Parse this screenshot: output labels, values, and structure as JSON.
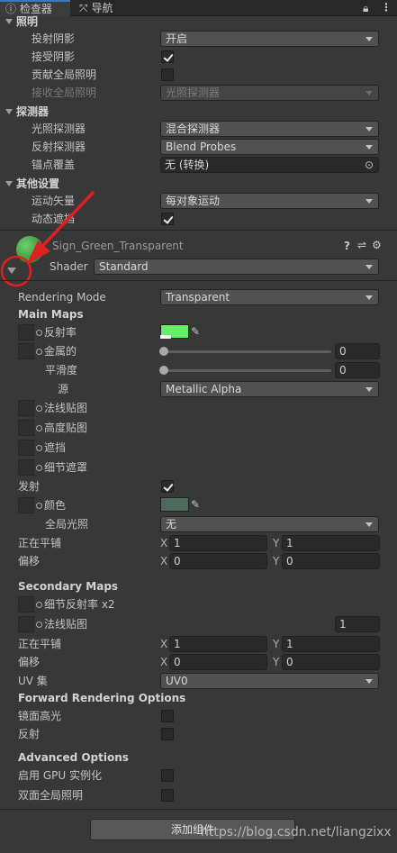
{
  "tabs": {
    "inspector_label": "检查器",
    "navigation_label": "导航"
  },
  "lighting": {
    "title": "照明",
    "cast_shadows_label": "投射阴影",
    "cast_shadows_value": "开启",
    "receive_shadows_label": "接受阴影",
    "contribute_gi_label": "贡献全局照明",
    "receive_gi_label": "接收全局照明",
    "receive_gi_value": "光照探测器"
  },
  "probes": {
    "title": "探测器",
    "light_probes_label": "光照探测器",
    "light_probes_value": "混合探测器",
    "reflection_probes_label": "反射探测器",
    "reflection_probes_value": "Blend Probes",
    "anchor_label": "锚点覆盖",
    "anchor_value": "无 (转换)"
  },
  "other": {
    "title": "其他设置",
    "motion_vectors_label": "运动矢量",
    "motion_vectors_value": "每对象运动",
    "dynamic_occlusion_label": "动态遮挡"
  },
  "material": {
    "name": "Sign_Green_Transparent",
    "shader_label": "Shader",
    "shader_value": "Standard",
    "preview_color": "#3f9a3f",
    "annotation_color": "#e02020"
  },
  "rendering": {
    "mode_label": "Rendering Mode",
    "mode_value": "Transparent"
  },
  "main_maps": {
    "title": "Main Maps",
    "albedo_label": "反射率",
    "albedo_color": "#66ee66",
    "metallic_label": "金属的",
    "metallic_value": "0",
    "smoothness_label": "平滑度",
    "smoothness_value": "0",
    "source_label": "源",
    "source_value": "Metallic Alpha",
    "normal_label": "法线贴图",
    "height_label": "高度贴图",
    "occlusion_label": "遮挡",
    "detail_mask_label": "细节遮罩",
    "emission_label": "发射",
    "emission_color_label": "颜色",
    "emission_color": "#4a6a5a",
    "gi_label": "全局光照",
    "gi_value": "无",
    "tiling_label": "正在平铺",
    "tiling_x": "1",
    "tiling_y": "1",
    "offset_label": "偏移",
    "offset_x": "0",
    "offset_y": "0",
    "x_label": "X",
    "y_label": "Y"
  },
  "secondary_maps": {
    "title": "Secondary Maps",
    "detail_albedo_label": "细节反射率 x2",
    "normal_label": "法线贴图",
    "normal_value": "1",
    "tiling_label": "正在平铺",
    "tiling_x": "1",
    "tiling_y": "1",
    "offset_label": "偏移",
    "offset_x": "0",
    "offset_y": "0",
    "uv_label": "UV 集",
    "uv_value": "UV0"
  },
  "forward": {
    "title": "Forward Rendering Options",
    "specular_label": "镜面高光",
    "reflections_label": "反射"
  },
  "advanced": {
    "title": "Advanced Options",
    "gpu_instancing_label": "启用 GPU 实例化",
    "double_sided_gi_label": "双面全局照明"
  },
  "add_component_label": "添加组件",
  "watermark": "https://blog.csdn.net/liangzixx"
}
